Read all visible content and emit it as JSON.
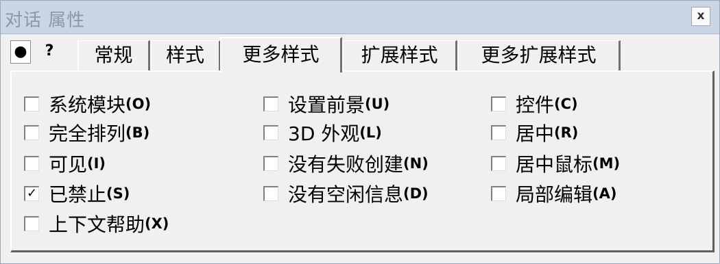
{
  "window": {
    "title": "对话 属性",
    "close_label": "x"
  },
  "toolbar": {
    "pin_glyph": "●",
    "help_glyph": "?"
  },
  "tabs": [
    {
      "label": "常规",
      "active": false
    },
    {
      "label": "样式",
      "active": false
    },
    {
      "label": "更多样式",
      "active": true
    },
    {
      "label": "扩展样式",
      "active": false
    },
    {
      "label": "更多扩展样式",
      "active": false
    }
  ],
  "options": {
    "col1": [
      {
        "label": "系统模块",
        "key": "(O)",
        "checked": false
      },
      {
        "label": "完全排列",
        "key": "(B)",
        "checked": false
      },
      {
        "label": "可见",
        "key": "(I)",
        "checked": false
      },
      {
        "label": "已禁止",
        "key": "(S)",
        "checked": true
      },
      {
        "label": "上下文帮助",
        "key": "(X)",
        "checked": false
      }
    ],
    "col2": [
      {
        "label": "设置前景",
        "key": "(U)",
        "checked": false
      },
      {
        "label": "3D 外观",
        "key": "(L)",
        "checked": false
      },
      {
        "label": "没有失败创建",
        "key": "(N)",
        "checked": false
      },
      {
        "label": "没有空闲信息",
        "key": "(D)",
        "checked": false
      }
    ],
    "col3": [
      {
        "label": "控件",
        "key": "(C)",
        "checked": false
      },
      {
        "label": "居中",
        "key": "(R)",
        "checked": false
      },
      {
        "label": "居中鼠标",
        "key": "(M)",
        "checked": false
      },
      {
        "label": "局部编辑",
        "key": "(A)",
        "checked": false
      }
    ]
  },
  "check_glyph": "✓"
}
